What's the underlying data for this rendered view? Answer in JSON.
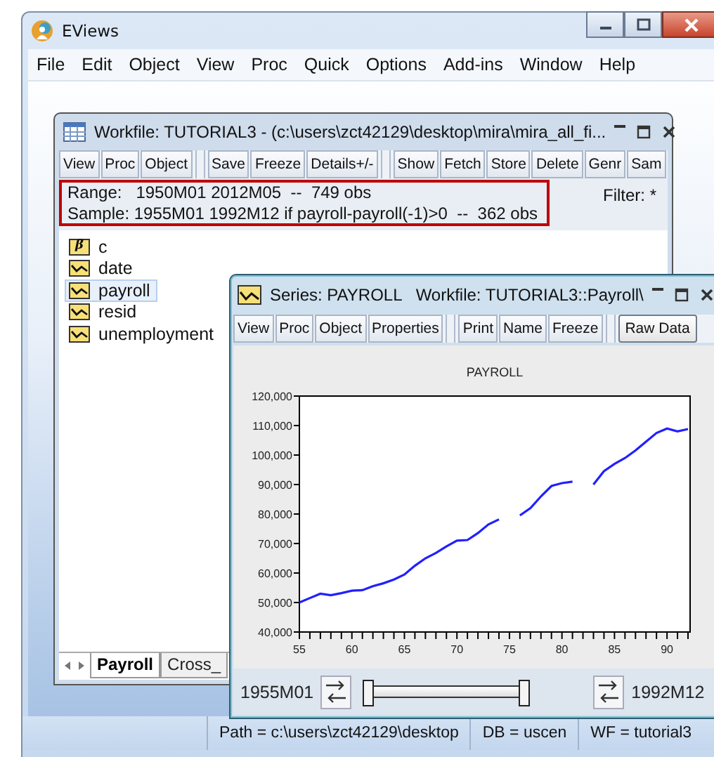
{
  "window": {
    "title": "EViews"
  },
  "menu": [
    "File",
    "Edit",
    "Object",
    "View",
    "Proc",
    "Quick",
    "Options",
    "Add-ins",
    "Window",
    "Help"
  ],
  "workfile": {
    "title": "Workfile: TUTORIAL3 - (c:\\users\\zct42129\\desktop\\mira\\mira_all_fi...",
    "toolbar": [
      [
        "View",
        "Proc",
        "Object"
      ],
      [
        "Save",
        "Freeze",
        "Details+/-"
      ],
      [
        "Show",
        "Fetch",
        "Store",
        "Delete",
        "Genr",
        "Sam"
      ]
    ],
    "range": "Range:   1950M01 2012M05  --  749 obs",
    "sample": "Sample: 1955M01 1992M12 if payroll-payroll(-1)>0  --  362 obs",
    "filter": "Filter: *",
    "objects": [
      {
        "name": "c",
        "kind": "coef",
        "badge": "β",
        "selected": false
      },
      {
        "name": "date",
        "kind": "series",
        "selected": false
      },
      {
        "name": "payroll",
        "kind": "series",
        "selected": true
      },
      {
        "name": "resid",
        "kind": "series",
        "selected": false
      },
      {
        "name": "unemployment",
        "kind": "series",
        "selected": false
      }
    ],
    "sheet_tabs": [
      {
        "label": "Payroll",
        "selected": true
      },
      {
        "label": "Cross_",
        "selected": false
      }
    ]
  },
  "series_window": {
    "title": "Series: PAYROLL   Workfile: TUTORIAL3::Payroll\\",
    "toolbar": [
      [
        "View",
        "Proc",
        "Object",
        "Properties"
      ],
      [
        "Print",
        "Name",
        "Freeze"
      ]
    ],
    "view_button": "Raw Data",
    "chart_data": {
      "type": "line",
      "title": "PAYROLL",
      "x": [
        55,
        56,
        57,
        58,
        59,
        60,
        61,
        62,
        63,
        64,
        65,
        66,
        67,
        68,
        69,
        70,
        71,
        72,
        73,
        74,
        75,
        76,
        77,
        78,
        79,
        80,
        81,
        82,
        83,
        84,
        85,
        86,
        87,
        88,
        89,
        90,
        91,
        92
      ],
      "series": [
        {
          "color": "#2020ff",
          "values": [
            50000,
            51500,
            53000,
            52500,
            53200,
            54000,
            54200,
            55500,
            56500,
            57800,
            59500,
            62500,
            65000,
            66800,
            69000,
            71000,
            71200,
            73500,
            76500,
            78200,
            null,
            79500,
            82000,
            86000,
            89500,
            90500,
            91000,
            null,
            90000,
            94500,
            97000,
            99000,
            101500,
            104500,
            107500,
            109000,
            108000,
            108800
          ]
        }
      ],
      "xlim": [
        55,
        92.2
      ],
      "ylim": [
        40000,
        120000
      ],
      "xticks": [
        55,
        60,
        65,
        70,
        75,
        80,
        85,
        90
      ],
      "yticks": [
        {
          "value": 40000,
          "label": "40,000"
        },
        {
          "value": 50000,
          "label": "50,000"
        },
        {
          "value": 60000,
          "label": "60,000"
        },
        {
          "value": 70000,
          "label": "70,000"
        },
        {
          "value": 80000,
          "label": "80,000"
        },
        {
          "value": 90000,
          "label": "90,000"
        },
        {
          "value": 100000,
          "label": "100,000"
        },
        {
          "value": 110000,
          "label": "110,000"
        },
        {
          "value": 120000,
          "label": "120,000"
        }
      ]
    },
    "start": "1955M01",
    "sample_slider": {
      "level": 0.72
    },
    "end": "1992M12"
  },
  "status_bar": [
    "Path = c:\\users\\zct42129\\desktop",
    "DB = uscen",
    "WF = tutorial3"
  ]
}
